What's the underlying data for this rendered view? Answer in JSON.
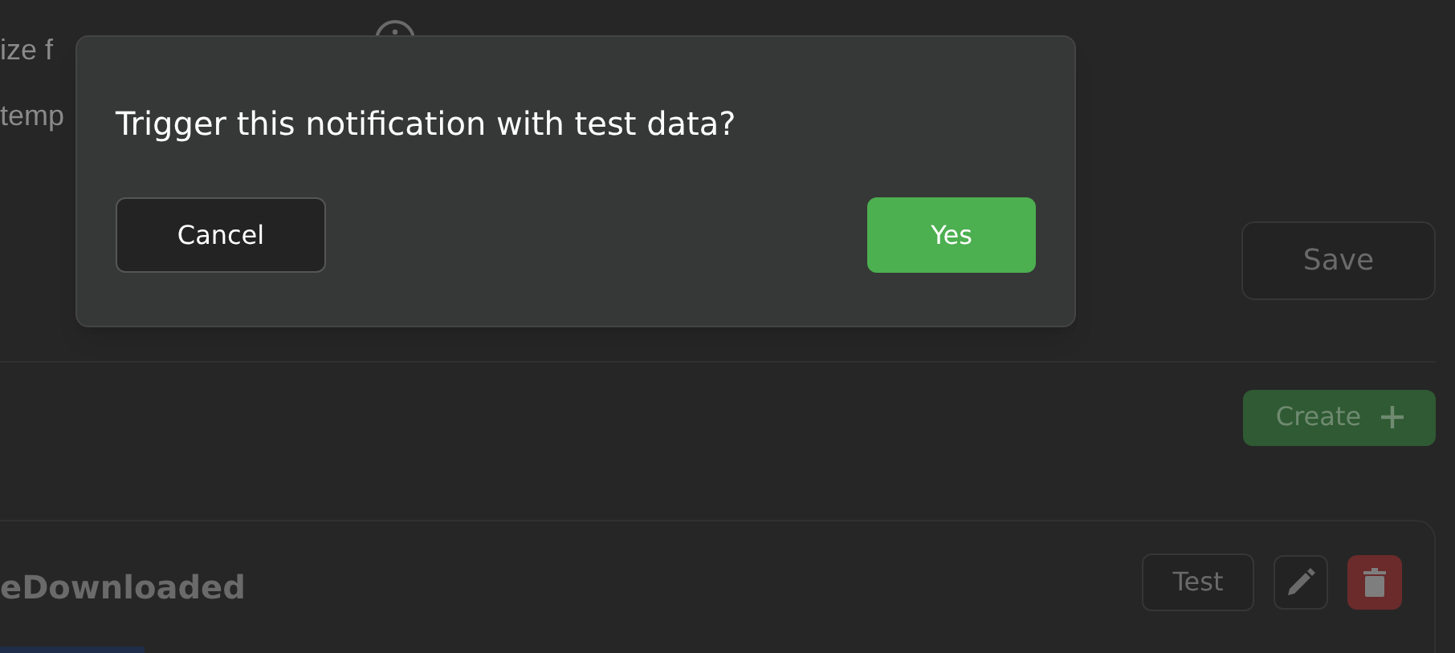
{
  "background": {
    "field_label": "ize f",
    "template_label": "temp",
    "save_button": "Save",
    "create_button": "Create",
    "notification": {
      "title": "eDownloaded",
      "test_button": "Test"
    }
  },
  "dialog": {
    "message": "Trigger this notification with test data?",
    "cancel_button": "Cancel",
    "confirm_button": "Yes"
  }
}
